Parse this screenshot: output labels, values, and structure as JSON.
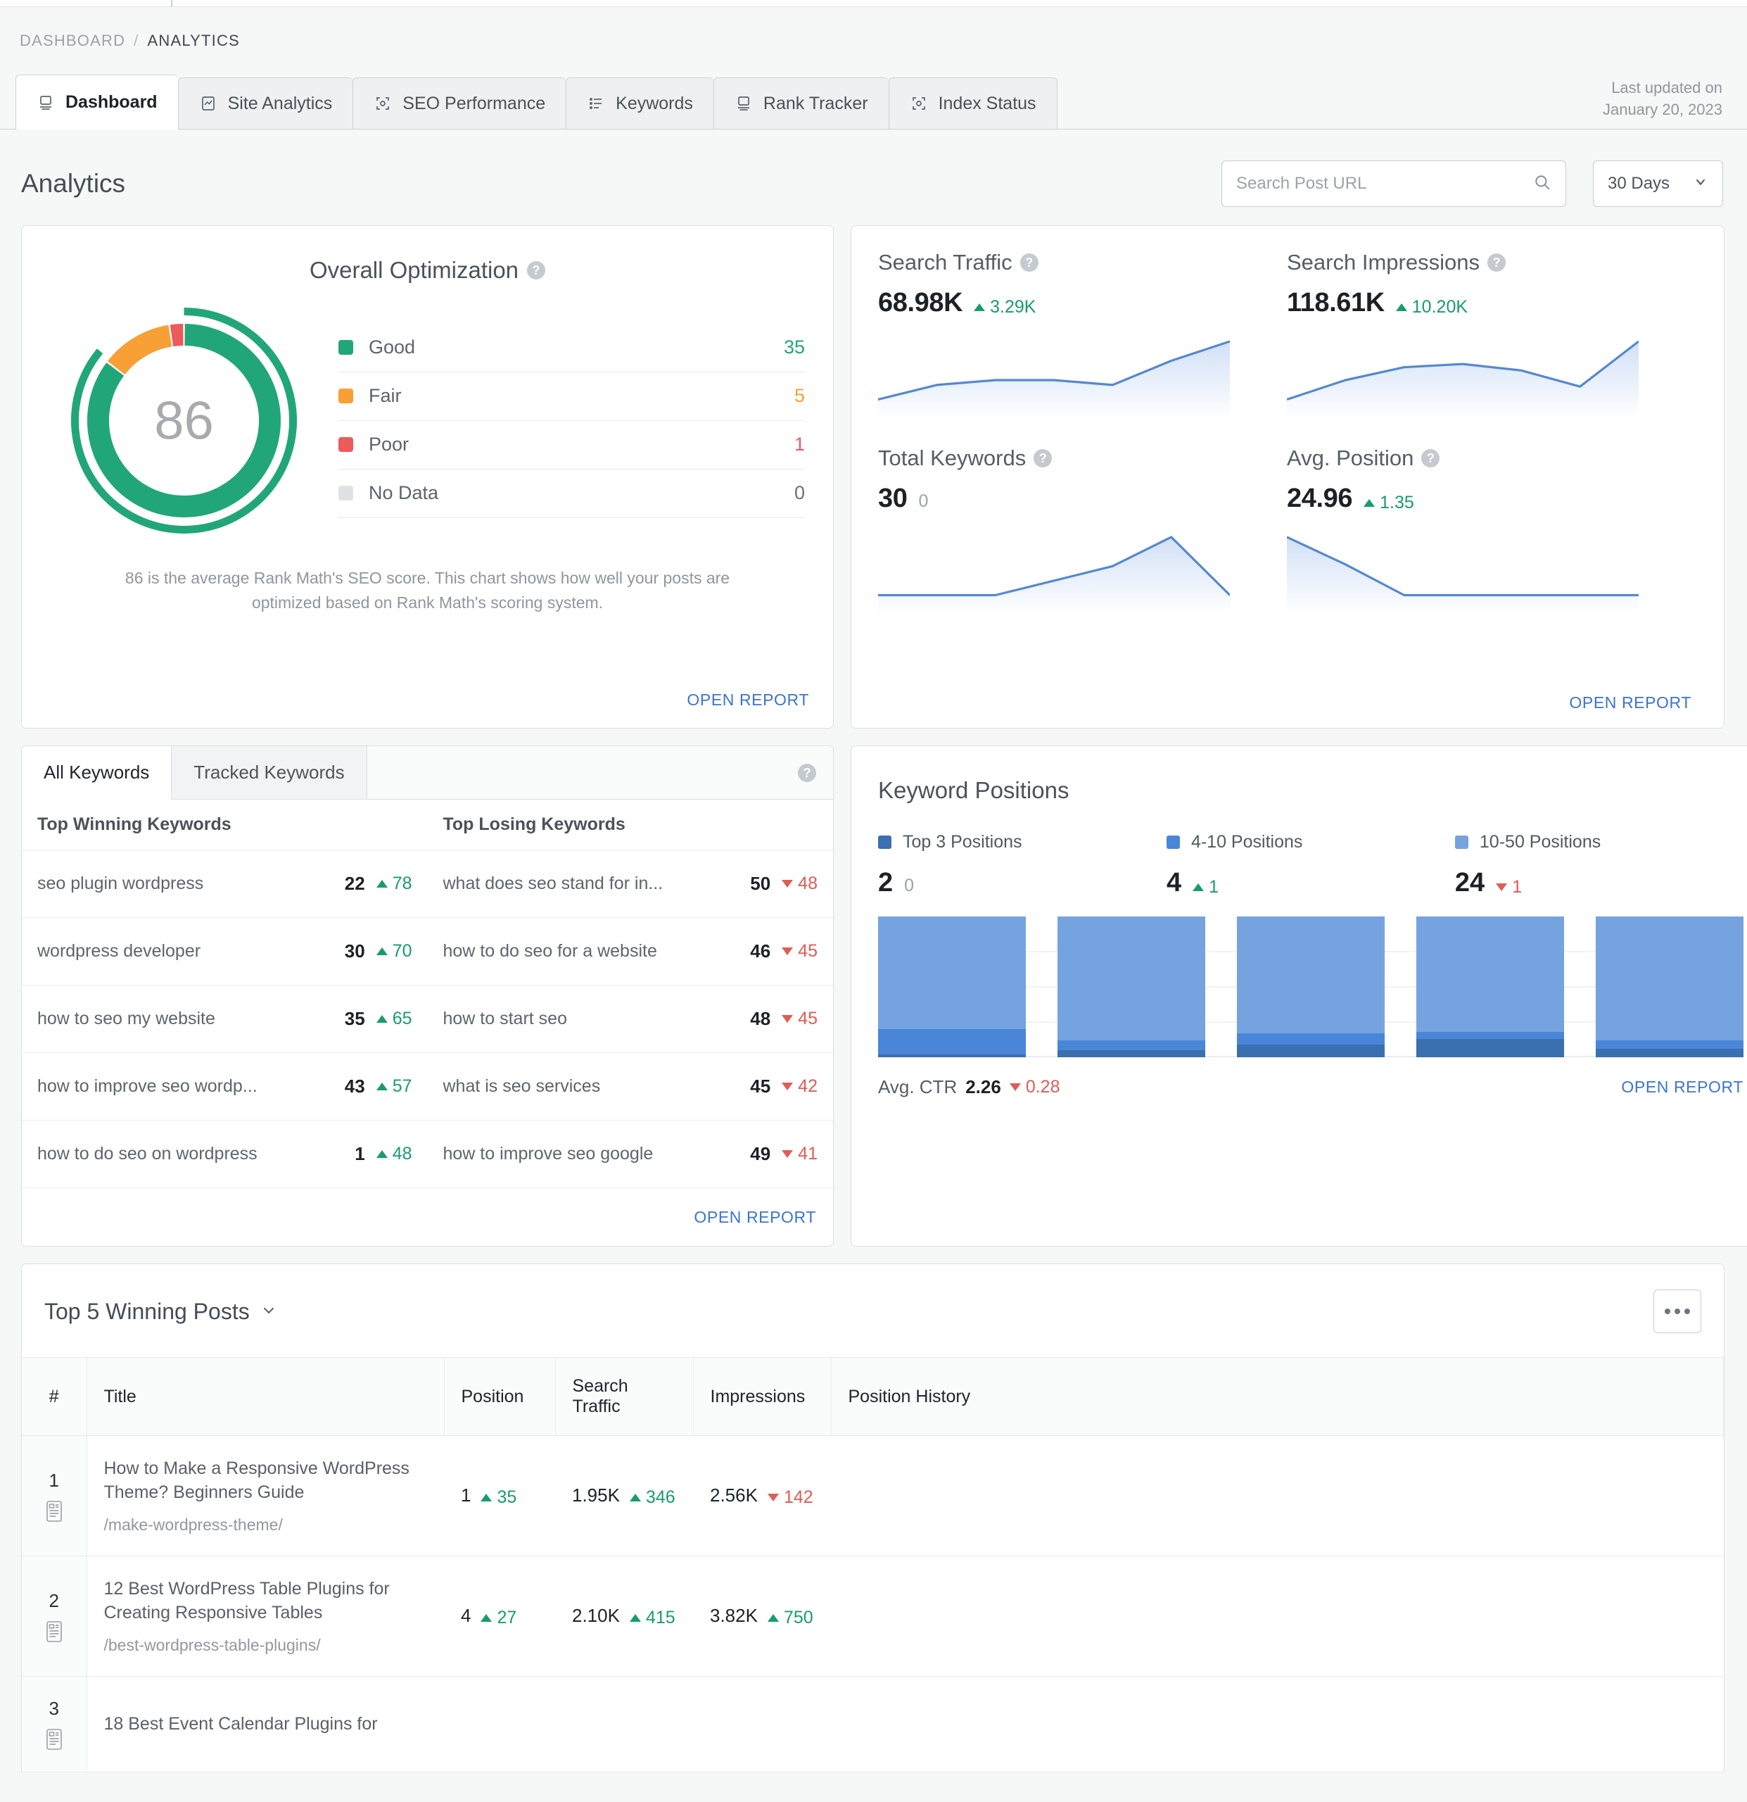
{
  "breadcrumb": {
    "root": "DASHBOARD",
    "sep": "/",
    "current": "ANALYTICS"
  },
  "tabs": [
    {
      "label": "Dashboard",
      "icon": "monitor-icon",
      "active": true
    },
    {
      "label": "Site Analytics",
      "icon": "chart-image-icon",
      "active": false
    },
    {
      "label": "SEO Performance",
      "icon": "focus-target-icon",
      "active": false
    },
    {
      "label": "Keywords",
      "icon": "list-icon",
      "active": false
    },
    {
      "label": "Rank Tracker",
      "icon": "monitor-icon",
      "active": false
    },
    {
      "label": "Index Status",
      "icon": "focus-target-icon",
      "active": false
    }
  ],
  "last_updated": {
    "label": "Last updated on",
    "date": "January 20, 2023"
  },
  "page": {
    "title": "Analytics"
  },
  "search": {
    "placeholder": "Search Post URL",
    "value": "",
    "icon": "search-icon"
  },
  "range_select": {
    "value": "30 Days",
    "icon": "chevron-down-icon"
  },
  "open_report_label": "OPEN REPORT",
  "optimization": {
    "title": "Overall Optimization",
    "score": "86",
    "description": "86 is the average Rank Math's SEO score. This chart shows how well your posts are optimized based on Rank Math's scoring system.",
    "legend": [
      {
        "label": "Good",
        "value": "35",
        "color": "#21a67a"
      },
      {
        "label": "Fair",
        "value": "5",
        "color": "#f6a036"
      },
      {
        "label": "Poor",
        "value": "1",
        "color": "#ec5a5a"
      },
      {
        "label": "No Data",
        "value": "0",
        "color": "#dfe2e5"
      }
    ]
  },
  "metrics": [
    {
      "label": "Search Traffic",
      "value": "68.98K",
      "delta": "3.29K",
      "dir": "up"
    },
    {
      "label": "Search Impressions",
      "value": "118.61K",
      "delta": "10.20K",
      "dir": "up"
    },
    {
      "label": "Total Keywords",
      "value": "30",
      "delta": "0",
      "dir": "zero"
    },
    {
      "label": "Avg. Position",
      "value": "24.96",
      "delta": "1.35",
      "dir": "up"
    }
  ],
  "keywords_panel": {
    "tabs": [
      {
        "label": "All Keywords",
        "active": true
      },
      {
        "label": "Tracked Keywords",
        "active": false
      }
    ],
    "col_winning": "Top Winning Keywords",
    "col_losing": "Top Losing Keywords",
    "winning": [
      {
        "keyword": "seo plugin wordpress",
        "position": "22",
        "delta": "78",
        "dir": "up"
      },
      {
        "keyword": "wordpress developer",
        "position": "30",
        "delta": "70",
        "dir": "up"
      },
      {
        "keyword": "how to seo my website",
        "position": "35",
        "delta": "65",
        "dir": "up"
      },
      {
        "keyword": "how to improve seo wordp...",
        "position": "43",
        "delta": "57",
        "dir": "up"
      },
      {
        "keyword": "how to do seo on wordpress",
        "position": "1",
        "delta": "48",
        "dir": "up"
      }
    ],
    "losing": [
      {
        "keyword": "what does seo stand for in...",
        "position": "50",
        "delta": "48",
        "dir": "down"
      },
      {
        "keyword": "how to do seo for a website",
        "position": "46",
        "delta": "45",
        "dir": "down"
      },
      {
        "keyword": "how to start seo",
        "position": "48",
        "delta": "45",
        "dir": "down"
      },
      {
        "keyword": "what is seo services",
        "position": "45",
        "delta": "42",
        "dir": "down"
      },
      {
        "keyword": "how to improve seo google",
        "position": "49",
        "delta": "41",
        "dir": "down"
      }
    ]
  },
  "keyword_positions": {
    "title": "Keyword Positions",
    "avg_ctr_label": "Avg. CTR",
    "avg_ctr_value": "2.26",
    "avg_ctr_delta": "0.28",
    "avg_ctr_dir": "down",
    "buckets": [
      {
        "label": "Top 3 Positions",
        "value": "2",
        "delta": "0",
        "dir": "zero",
        "color": "#3a6fb0"
      },
      {
        "label": "4-10 Positions",
        "value": "4",
        "delta": "1",
        "dir": "up",
        "color": "#4986d8"
      },
      {
        "label": "10-50 Positions",
        "value": "24",
        "delta": "1",
        "dir": "down",
        "color": "#74a3e0"
      }
    ]
  },
  "posts": {
    "title": "Top 5 Winning Posts",
    "menu_icon": "ellipsis-icon",
    "columns": [
      "#",
      "Title",
      "Position",
      "Search Traffic",
      "Impressions",
      "Position History"
    ],
    "rows": [
      {
        "num": "1",
        "title": "How to Make a Responsive WordPress Theme? Beginners Guide",
        "url": "/make-wordpress-theme/",
        "position": "1",
        "position_delta": "35",
        "position_dir": "up",
        "traffic": "1.95K",
        "traffic_delta": "346",
        "traffic_dir": "up",
        "impressions": "2.56K",
        "impressions_delta": "142",
        "impressions_dir": "down"
      },
      {
        "num": "2",
        "title": "12 Best WordPress Table Plugins for Creating Responsive Tables",
        "url": "/best-wordpress-table-plugins/",
        "position": "4",
        "position_delta": "27",
        "position_dir": "up",
        "traffic": "2.10K",
        "traffic_delta": "415",
        "traffic_dir": "up",
        "impressions": "3.82K",
        "impressions_delta": "750",
        "impressions_dir": "up"
      },
      {
        "num": "3",
        "title": "18 Best Event Calendar Plugins for",
        "url": "",
        "position": "",
        "position_delta": "",
        "position_dir": "up",
        "traffic": "",
        "traffic_delta": "",
        "traffic_dir": "up",
        "impressions": "",
        "impressions_delta": "",
        "impressions_dir": "up"
      }
    ]
  },
  "chart_data": [
    {
      "type": "pie",
      "title": "Overall Optimization",
      "labels": [
        "Good",
        "Fair",
        "Poor",
        "No Data"
      ],
      "values": [
        35,
        5,
        1,
        0
      ],
      "colors": [
        "#21a67a",
        "#f6a036",
        "#ec5a5a",
        "#dfe2e5"
      ],
      "center_value": 86,
      "legend": "right"
    },
    {
      "type": "line",
      "title": "Search Traffic",
      "x": [
        1,
        2,
        3,
        4,
        5,
        6,
        7
      ],
      "values": [
        60,
        63,
        64,
        64,
        63,
        68,
        72
      ],
      "ylabel": "",
      "grid": false
    },
    {
      "type": "line",
      "title": "Search Impressions",
      "x": [
        1,
        2,
        3,
        4,
        5,
        6,
        7
      ],
      "values": [
        60,
        66,
        70,
        71,
        69,
        64,
        78
      ],
      "ylabel": "",
      "grid": false
    },
    {
      "type": "line",
      "title": "Total Keywords",
      "x": [
        1,
        2,
        3,
        4,
        5,
        6,
        7
      ],
      "values": [
        30,
        30,
        30,
        31,
        32,
        34,
        30
      ],
      "ylabel": "",
      "grid": false
    },
    {
      "type": "line",
      "title": "Avg. Position",
      "x": [
        1,
        2,
        3,
        4,
        5,
        6,
        7
      ],
      "values": [
        40,
        24,
        6,
        6,
        6,
        6,
        6
      ],
      "ylabel": "",
      "grid": false
    },
    {
      "type": "bar",
      "title": "Keyword Positions",
      "categories": [
        "1",
        "2",
        "3",
        "4",
        "5"
      ],
      "stacked": true,
      "series": [
        {
          "name": "Top 3 Positions",
          "values": [
            2,
            5,
            9,
            13,
            6
          ],
          "color": "#3a6fb0"
        },
        {
          "name": "4-10 Positions",
          "values": [
            18,
            7,
            8,
            5,
            6
          ],
          "color": "#4986d8"
        },
        {
          "name": "10-50 Positions",
          "values": [
            80,
            88,
            83,
            82,
            88
          ],
          "color": "#74a3e0"
        }
      ],
      "ylim": [
        0,
        100
      ],
      "grid": true,
      "legend": "top"
    }
  ]
}
